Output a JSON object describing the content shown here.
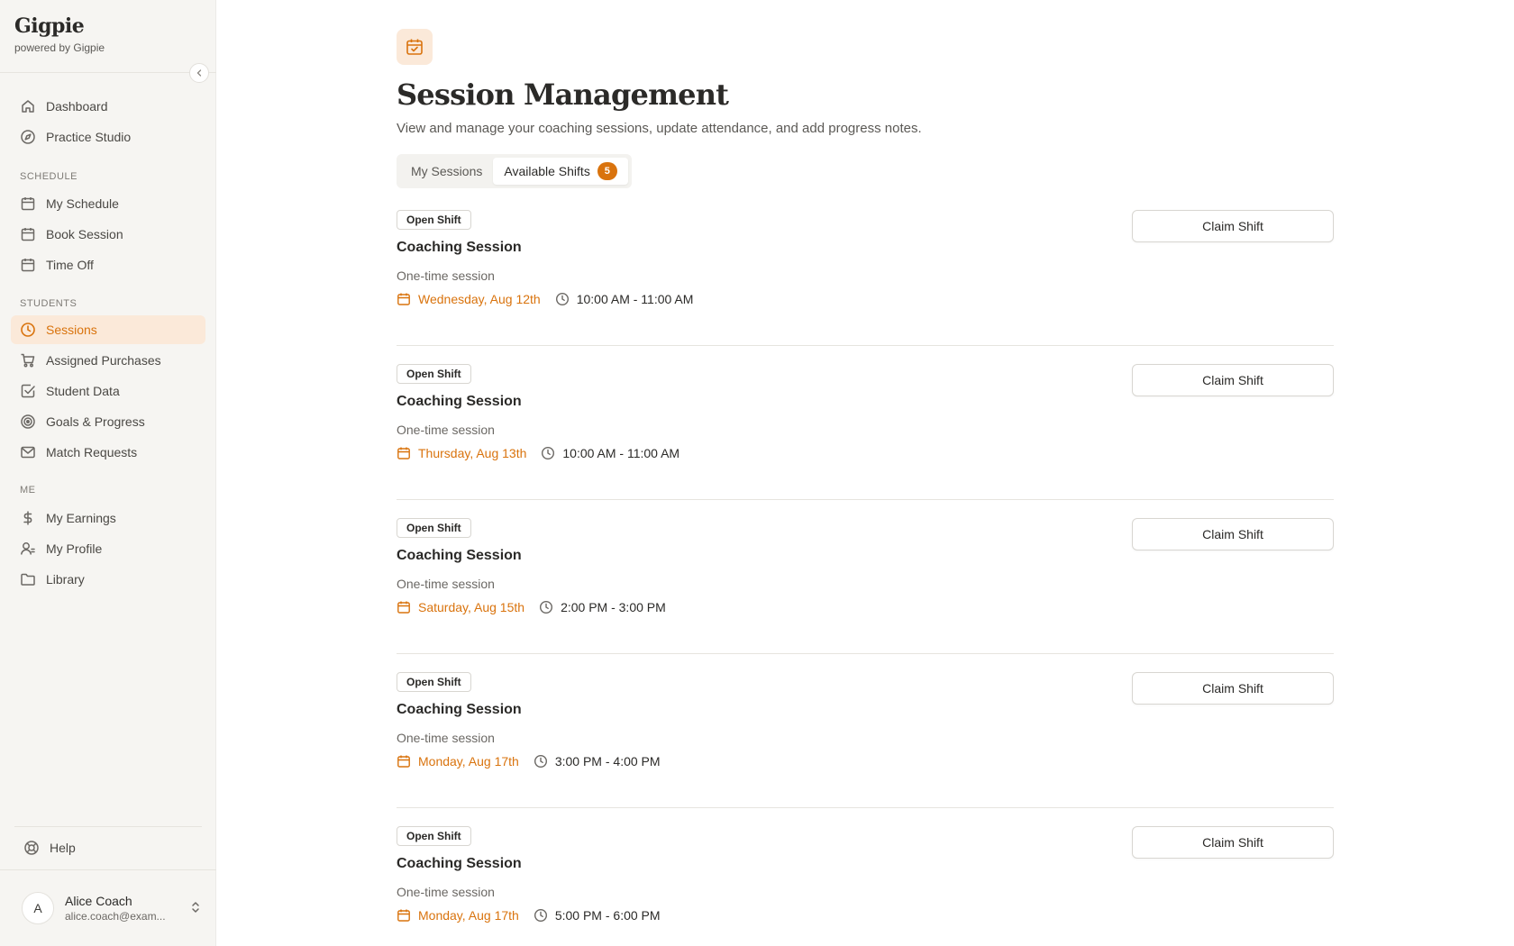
{
  "brand": {
    "name": "Gigpie",
    "sub": "powered by Gigpie"
  },
  "sidebar": {
    "top_items": [
      {
        "label": "Dashboard",
        "icon": "home-icon"
      },
      {
        "label": "Practice Studio",
        "icon": "compass-icon"
      }
    ],
    "sections": {
      "schedule": "SCHEDULE",
      "students": "STUDENTS",
      "me": "ME"
    },
    "schedule_items": [
      {
        "label": "My Schedule",
        "icon": "calendar-icon"
      },
      {
        "label": "Book Session",
        "icon": "calendar-icon"
      },
      {
        "label": "Time Off",
        "icon": "calendar-icon"
      }
    ],
    "students_items": [
      {
        "label": "Sessions",
        "icon": "clock-icon",
        "active": true
      },
      {
        "label": "Assigned Purchases",
        "icon": "cart-icon"
      },
      {
        "label": "Student Data",
        "icon": "checkbox-icon"
      },
      {
        "label": "Goals & Progress",
        "icon": "target-icon"
      },
      {
        "label": "Match Requests",
        "icon": "mail-icon"
      }
    ],
    "me_items": [
      {
        "label": "My Earnings",
        "icon": "dollar-icon"
      },
      {
        "label": "My Profile",
        "icon": "user-icon"
      },
      {
        "label": "Library",
        "icon": "folder-icon"
      }
    ],
    "help": "Help",
    "user": {
      "initial": "A",
      "name": "Alice Coach",
      "email": "alice.coach@exam..."
    }
  },
  "main": {
    "title": "Session Management",
    "description": "View and manage your coaching sessions, update attendance, and add progress notes.",
    "tabs": [
      {
        "label": "My Sessions",
        "active": false
      },
      {
        "label": "Available Shifts",
        "active": true,
        "badge": "5"
      }
    ],
    "shifts": [
      {
        "tag": "Open Shift",
        "title": "Coaching Session",
        "sub": "One-time session",
        "date": "Wednesday, Aug 12th",
        "time": "10:00 AM - 11:00 AM",
        "button": "Claim Shift"
      },
      {
        "tag": "Open Shift",
        "title": "Coaching Session",
        "sub": "One-time session",
        "date": "Thursday, Aug 13th",
        "time": "10:00 AM - 11:00 AM",
        "button": "Claim Shift"
      },
      {
        "tag": "Open Shift",
        "title": "Coaching Session",
        "sub": "One-time session",
        "date": "Saturday, Aug 15th",
        "time": "2:00 PM - 3:00 PM",
        "button": "Claim Shift"
      },
      {
        "tag": "Open Shift",
        "title": "Coaching Session",
        "sub": "One-time session",
        "date": "Monday, Aug 17th",
        "time": "3:00 PM - 4:00 PM",
        "button": "Claim Shift"
      },
      {
        "tag": "Open Shift",
        "title": "Coaching Session",
        "sub": "One-time session",
        "date": "Monday, Aug 17th",
        "time": "5:00 PM - 6:00 PM",
        "button": "Claim Shift"
      }
    ]
  },
  "colors": {
    "accent": "#d9730d",
    "accent_bg": "#fbe9d9",
    "sidebar_bg": "#f6f5f2"
  }
}
